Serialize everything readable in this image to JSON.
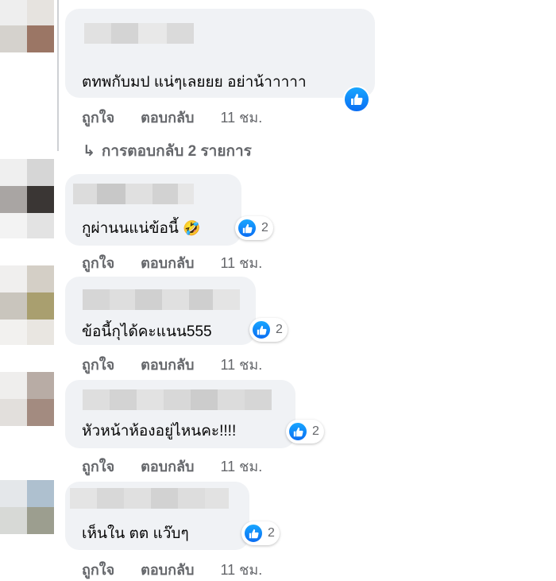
{
  "comments": [
    {
      "text": "ตทพกับมป แน่ๆเลยยย อย่าน้าาาาา",
      "actions": {
        "like": "ถูกใจ",
        "reply": "ตอบกลับ",
        "time": "11 ชม."
      },
      "reaction": {
        "icon": "like-icon",
        "count": ""
      },
      "replies_link": "การตอบกลับ 2 รายการ"
    },
    {
      "text": "กูผ่านนแน่ข้อนี้",
      "emoji": "🤣",
      "actions": {
        "like": "ถูกใจ",
        "reply": "ตอบกลับ",
        "time": "11 ชม."
      },
      "reaction": {
        "icon": "like-icon",
        "count": "2"
      }
    },
    {
      "text": "ข้อนี้กุได้คะแนน555",
      "actions": {
        "like": "ถูกใจ",
        "reply": "ตอบกลับ",
        "time": "11 ชม."
      },
      "reaction": {
        "icon": "like-icon",
        "count": "2"
      }
    },
    {
      "text": "หัวหน้าห้องอยู่ไหนคะ!!!!",
      "actions": {
        "like": "ถูกใจ",
        "reply": "ตอบกลับ",
        "time": "11 ชม."
      },
      "reaction": {
        "icon": "like-icon",
        "count": "2"
      }
    },
    {
      "text": "เห็นใน ตต แว๊บๆ",
      "actions": {
        "like": "ถูกใจ",
        "reply": "ตอบกลับ",
        "time": "11 ชม."
      },
      "reaction": {
        "icon": "like-icon",
        "count": "2"
      }
    }
  ],
  "colors": {
    "bubble": "#f0f2f5",
    "secondary_text": "#65676b",
    "like_blue": "#0a6df3"
  }
}
